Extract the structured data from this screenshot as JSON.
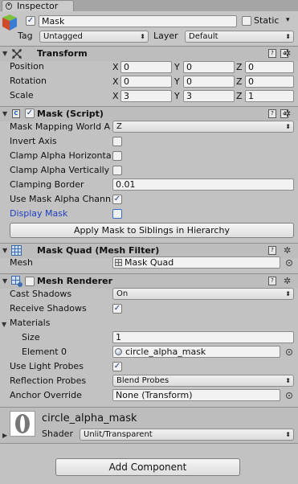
{
  "window": {
    "tab_title": "Inspector"
  },
  "object": {
    "name": "Mask",
    "static_label": "Static",
    "static_checked": false,
    "active_checked": true,
    "tag_label": "Tag",
    "tag_value": "Untagged",
    "layer_label": "Layer",
    "layer_value": "Default"
  },
  "transform": {
    "title": "Transform",
    "rows": [
      {
        "label": "Position",
        "x": "0",
        "y": "0",
        "z": "0"
      },
      {
        "label": "Rotation",
        "x": "0",
        "y": "0",
        "z": "0"
      },
      {
        "label": "Scale",
        "x": "3",
        "y": "3",
        "z": "1"
      }
    ],
    "axis_x": "X",
    "axis_y": "Y",
    "axis_z": "Z"
  },
  "mask_script": {
    "title": "Mask (Script)",
    "mapping_label": "Mask Mapping World A",
    "mapping_value": "Z",
    "invert_label": "Invert Axis",
    "clamp_h_label": "Clamp Alpha Horizonta",
    "clamp_v_label": "Clamp Alpha Vertically",
    "clamping_border_label": "Clamping Border",
    "clamping_border_value": "0.01",
    "use_alpha_label": "Use Mask Alpha Chann",
    "display_mask_label": "Display Mask",
    "apply_button": "Apply Mask to Siblings in Hierarchy"
  },
  "mesh_filter": {
    "title": "Mask Quad (Mesh Filter)",
    "mesh_label": "Mesh",
    "mesh_value": "Mask Quad"
  },
  "mesh_renderer": {
    "title": "Mesh Renderer",
    "cast_shadows_label": "Cast Shadows",
    "cast_shadows_value": "On",
    "receive_shadows_label": "Receive Shadows",
    "materials_label": "Materials",
    "size_label": "Size",
    "size_value": "1",
    "element0_label": "Element 0",
    "element0_value": "circle_alpha_mask",
    "light_probes_label": "Use Light Probes",
    "reflection_label": "Reflection Probes",
    "reflection_value": "Blend Probes",
    "anchor_label": "Anchor Override",
    "anchor_value": "None (Transform)"
  },
  "material": {
    "name": "circle_alpha_mask",
    "shader_label": "Shader",
    "shader_value": "Unlit/Transparent"
  },
  "add_component": "Add Component",
  "check_glyph": "✓",
  "gear_glyph": "✲",
  "help_glyph": "?",
  "dropdown_glyph": "▾",
  "fold_open_glyph": "▼",
  "fold_closed_glyph": "▶"
}
